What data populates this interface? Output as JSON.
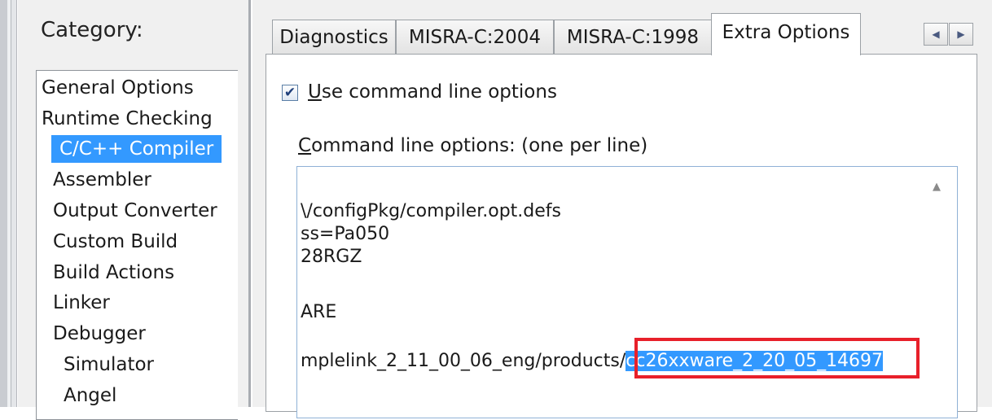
{
  "category": {
    "label": "Category:",
    "items": [
      {
        "label": "General Options",
        "selected": false
      },
      {
        "label": "Runtime Checking",
        "selected": false
      },
      {
        "label": "C/C++ Compiler",
        "selected": true
      },
      {
        "label": "Assembler",
        "selected": false
      },
      {
        "label": "Output Converter",
        "selected": false
      },
      {
        "label": "Custom Build",
        "selected": false
      },
      {
        "label": "Build Actions",
        "selected": false
      },
      {
        "label": "Linker",
        "selected": false
      },
      {
        "label": "Debugger",
        "selected": false
      },
      {
        "label": "Simulator",
        "selected": false
      },
      {
        "label": "Angel",
        "selected": false
      }
    ]
  },
  "tabs": [
    {
      "label": "Diagnostics",
      "active": false
    },
    {
      "label": "MISRA-C:2004",
      "active": false
    },
    {
      "label": "MISRA-C:1998",
      "active": false
    },
    {
      "label": "Extra Options",
      "active": true
    }
  ],
  "tab_scroll": {
    "left_icon": "scroll-left-icon",
    "right_icon": "scroll-right-icon"
  },
  "use_command_line": {
    "checked": true,
    "label_accel": "U",
    "label_rest": "se command line options"
  },
  "command_line_options": {
    "label_accel": "C",
    "label_rest": "ommand line options:  (one per line)",
    "lines": [
      "\\/configPkg/compiler.opt.defs",
      "ss=Pa050",
      "28RGZ",
      "",
      "ARE"
    ],
    "last_line_prefix": "mplelink_2_11_00_06_eng/products/",
    "last_line_selected": "cc26xxware_2_20_05_14697"
  },
  "colors": {
    "selection": "#3399ff",
    "highlight_box": "#e8202a",
    "panel_bg": "#f0f0f0"
  }
}
